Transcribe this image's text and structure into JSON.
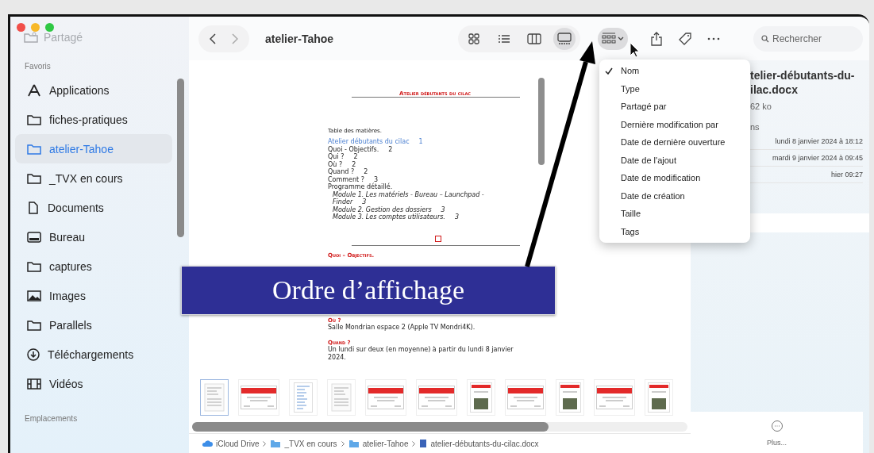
{
  "window": {
    "title": "atelier-Tahoe"
  },
  "sidebar": {
    "scrolled_item": {
      "label": "Partagé",
      "kind": "shared-folder"
    },
    "sections": [
      {
        "title": "Favoris",
        "items": [
          {
            "label": "Applications",
            "kind": "apps",
            "selected": false
          },
          {
            "label": "fiches-pratiques",
            "kind": "folder",
            "selected": false
          },
          {
            "label": "atelier-Tahoe",
            "kind": "folder",
            "selected": true
          },
          {
            "label": "_TVX en cours",
            "kind": "folder",
            "selected": false
          },
          {
            "label": "Documents",
            "kind": "doc",
            "selected": false
          },
          {
            "label": "Bureau",
            "kind": "desktop",
            "selected": false
          },
          {
            "label": "captures",
            "kind": "folder",
            "selected": false
          },
          {
            "label": "Images",
            "kind": "image",
            "selected": false
          },
          {
            "label": "Parallels",
            "kind": "folder",
            "selected": false
          },
          {
            "label": "Téléchargements",
            "kind": "download",
            "selected": false
          },
          {
            "label": "Vidéos",
            "kind": "film",
            "selected": false
          }
        ]
      },
      {
        "title": "Emplacements"
      }
    ]
  },
  "toolbar": {
    "views": [
      {
        "kind": "icons",
        "selected": false
      },
      {
        "kind": "list",
        "selected": false
      },
      {
        "kind": "columns",
        "selected": false
      },
      {
        "kind": "gallery",
        "selected": true
      }
    ],
    "group_menu_open": true,
    "search": {
      "placeholder": "Rechercher"
    }
  },
  "sort_menu": {
    "items": [
      {
        "label": "Nom",
        "checked": true
      },
      {
        "label": "Type",
        "checked": false
      },
      {
        "label": "Partagé par",
        "checked": false
      },
      {
        "label": "Dernière modification par",
        "checked": false
      },
      {
        "label": "Date de dernière ouverture",
        "checked": false
      },
      {
        "label": "Date de l'ajout",
        "checked": false
      },
      {
        "label": "Date de modification",
        "checked": false
      },
      {
        "label": "Date de création",
        "checked": false
      },
      {
        "label": "Taille",
        "checked": false
      },
      {
        "label": "Tags",
        "checked": false
      }
    ]
  },
  "document": {
    "heading": "Atelier débutants du cilac",
    "toc_title": "Table des matières.",
    "toc": [
      {
        "kind": "link",
        "text": "Atelier débutants du cilac",
        "number": "1"
      },
      {
        "kind": "entry",
        "text": "Quoi - Objectifs.",
        "number": "2"
      },
      {
        "kind": "entry",
        "text": "Qui ?",
        "number": "2"
      },
      {
        "kind": "entry",
        "text": "Où ?",
        "number": "2"
      },
      {
        "kind": "entry",
        "text": "Quand ?",
        "number": "2"
      },
      {
        "kind": "entry",
        "text": "Comment ?",
        "number": "3"
      },
      {
        "kind": "entry",
        "text": "Programme détaillé."
      },
      {
        "kind": "sub",
        "text": "Module 1. Les matériels - Bureau – Launchpad - Finder",
        "number": "3"
      },
      {
        "kind": "sub",
        "text": "Module 2. Gestion des dossiers",
        "number": "3"
      },
      {
        "kind": "sub",
        "text": "Module 3. Les comptes utilisateurs.",
        "number": "3"
      }
    ],
    "section_heading": "Quoi – Objectifs.",
    "sections": [
      {
        "heading": "Où ?",
        "body": "Salle Mondrian espace 2 (Apple TV Mondri4K)."
      },
      {
        "heading": "Quand ?",
        "body": "Un lundi sur deux (en moyenne) à partir du lundi 8 janvier 2024."
      }
    ]
  },
  "thumbnails": [
    {
      "kind": "page",
      "selected": true
    },
    {
      "kind": "banner",
      "selected": false
    },
    {
      "kind": "list",
      "selected": false
    },
    {
      "kind": "page",
      "selected": false
    },
    {
      "kind": "banner",
      "selected": false
    },
    {
      "kind": "banner",
      "selected": false
    },
    {
      "kind": "photo",
      "selected": false
    },
    {
      "kind": "banner",
      "selected": false
    },
    {
      "kind": "photo",
      "selected": false
    },
    {
      "kind": "banner",
      "selected": false
    },
    {
      "kind": "photo",
      "selected": false
    }
  ],
  "path_bar": [
    {
      "label": "iCloud Drive",
      "kind": "cloud"
    },
    {
      "label": "_TVX en cours",
      "kind": "folder"
    },
    {
      "label": "atelier-Tahoe",
      "kind": "folder"
    },
    {
      "label": "atelier-débutants-du-cilac.docx",
      "kind": "doc"
    }
  ],
  "inspector": {
    "name_lines": [
      "telier-débutants-du-",
      "ilac.docx"
    ],
    "size": "62 ko",
    "section": "ns",
    "dates": [
      "lundi 8 janvier 2024 à 18:12",
      "mardi 9 janvier 2024 à 09:45",
      "hier 09:27"
    ],
    "more": "Plus..."
  },
  "annotation": {
    "text": "Ordre d’affichage"
  }
}
